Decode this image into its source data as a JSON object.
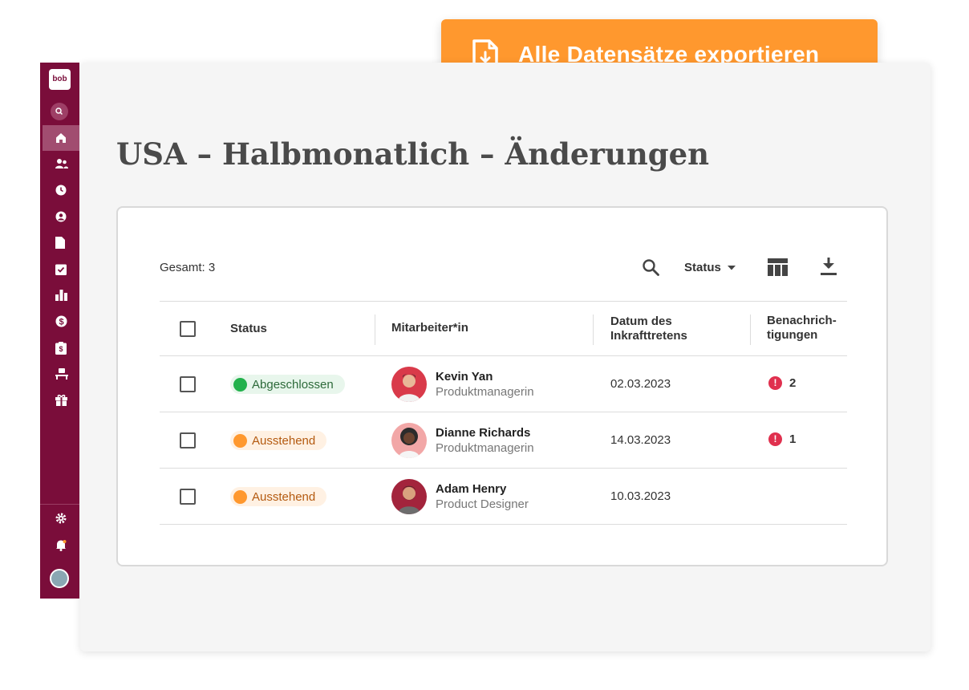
{
  "export_button": {
    "label": "Alle Datensätze exportieren",
    "icon": "file-download-icon",
    "color": "#ff982e"
  },
  "sidebar": {
    "brand_color": "#7a0d3a",
    "logo_text": "bob",
    "nav_icons": [
      "home-icon",
      "people-icon",
      "clock-icon",
      "user-circle-icon",
      "document-icon",
      "clipboard-check-icon",
      "bar-chart-icon",
      "dollar-icon",
      "clipboard-icon",
      "desk-icon",
      "gift-icon"
    ],
    "bottom_icons": [
      "gear-icon",
      "bell-icon",
      "user-avatar"
    ]
  },
  "page": {
    "title": "USA – Halbmonatlich – Änderungen"
  },
  "toolbar": {
    "total_label": "Gesamt: 3",
    "status_filter": "Status"
  },
  "table": {
    "headers": {
      "status": "Status",
      "employee": "Mitarbeiter*in",
      "effective_date": "Datum des Inkrafttretens",
      "notifications": "Benachrich-tigungen"
    },
    "rows": [
      {
        "status": "Abgeschlossen",
        "status_kind": "done",
        "name": "Kevin Yan",
        "role": "Produktmanagerin",
        "date": "02.03.2023",
        "notifications": "2",
        "avatar_color": "#d93a4a"
      },
      {
        "status": "Ausstehend",
        "status_kind": "pending",
        "name": "Dianne Richards",
        "role": "Produktmanagerin",
        "date": "14.03.2023",
        "notifications": "1",
        "avatar_color": "#f2a7a7"
      },
      {
        "status": "Ausstehend",
        "status_kind": "pending",
        "name": "Adam Henry",
        "role": "Product Designer",
        "date": "10.03.2023",
        "notifications": "",
        "avatar_color": "#a3243c"
      }
    ]
  }
}
